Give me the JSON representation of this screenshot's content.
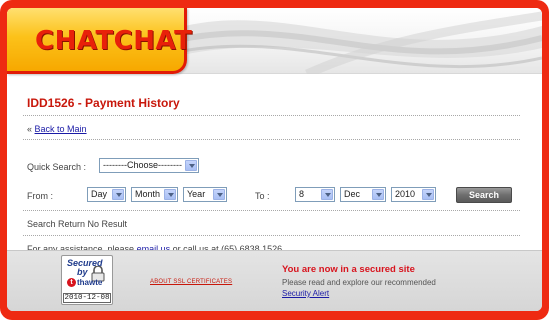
{
  "brand": {
    "logo_text": "CHATCHAT"
  },
  "page": {
    "title": "IDD1526 - Payment History"
  },
  "nav": {
    "back_prefix": "«",
    "back_link": "Back to Main"
  },
  "quick_search": {
    "label": "Quick Search :",
    "selected": "--------Choose--------"
  },
  "from": {
    "label": "From :",
    "day": "Day",
    "month": "Month",
    "year": "Year"
  },
  "to": {
    "label": "To :",
    "day": "8",
    "month": "Dec",
    "year": "2010"
  },
  "search_button": "Search",
  "result_text": "Search Return No Result",
  "assistance": {
    "prefix": "For any assistance, please",
    "link": "email us",
    "suffix": "or call us at (65) 6838 1526."
  },
  "footer": {
    "badge": {
      "line1": "Secured",
      "line2": "by",
      "brand": "thawte",
      "date": "2010-12-08"
    },
    "ssl_link": "ABOUT SSL CERTIFICATES",
    "secure_title": "You are now in a secured site",
    "secure_text": "Please read and explore our recommended",
    "security_alert": "Security Alert"
  },
  "colors": {
    "frame": "#ee2a12",
    "logo_fill": "#fcc21a",
    "title_red": "#c8170b",
    "link_blue": "#1a1aa6"
  }
}
